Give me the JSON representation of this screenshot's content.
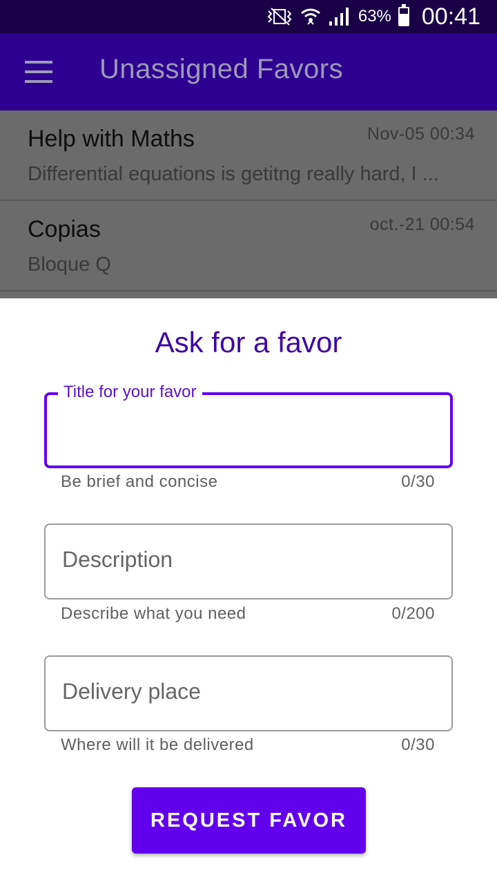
{
  "status_bar": {
    "battery": "63%",
    "time": "00:41"
  },
  "app_bar": {
    "title": "Unassigned Favors",
    "menu_icon": "hamburger-menu-icon"
  },
  "favors": [
    {
      "title": "Help with Maths",
      "description": "Differential equations is getitng really hard, I ...",
      "date": "Nov-05  00:34"
    },
    {
      "title": "Copias",
      "description": "Bloque Q",
      "date": "oct.-21  00:54"
    }
  ],
  "form": {
    "heading": "Ask for a favor",
    "title_field": {
      "label": "Title for your favor",
      "helper": "Be brief and concise",
      "counter": "0/30"
    },
    "description_field": {
      "placeholder": "Description",
      "helper": "Describe what you need",
      "counter": "0/200"
    },
    "delivery_field": {
      "placeholder": "Delivery place",
      "helper": "Where will it be delivered",
      "counter": "0/30"
    },
    "submit_label": "REQUEST FAVOR"
  },
  "colors": {
    "primary": "#6200ee",
    "app_bar": "#2d0090",
    "status_bar": "#1a0047"
  }
}
